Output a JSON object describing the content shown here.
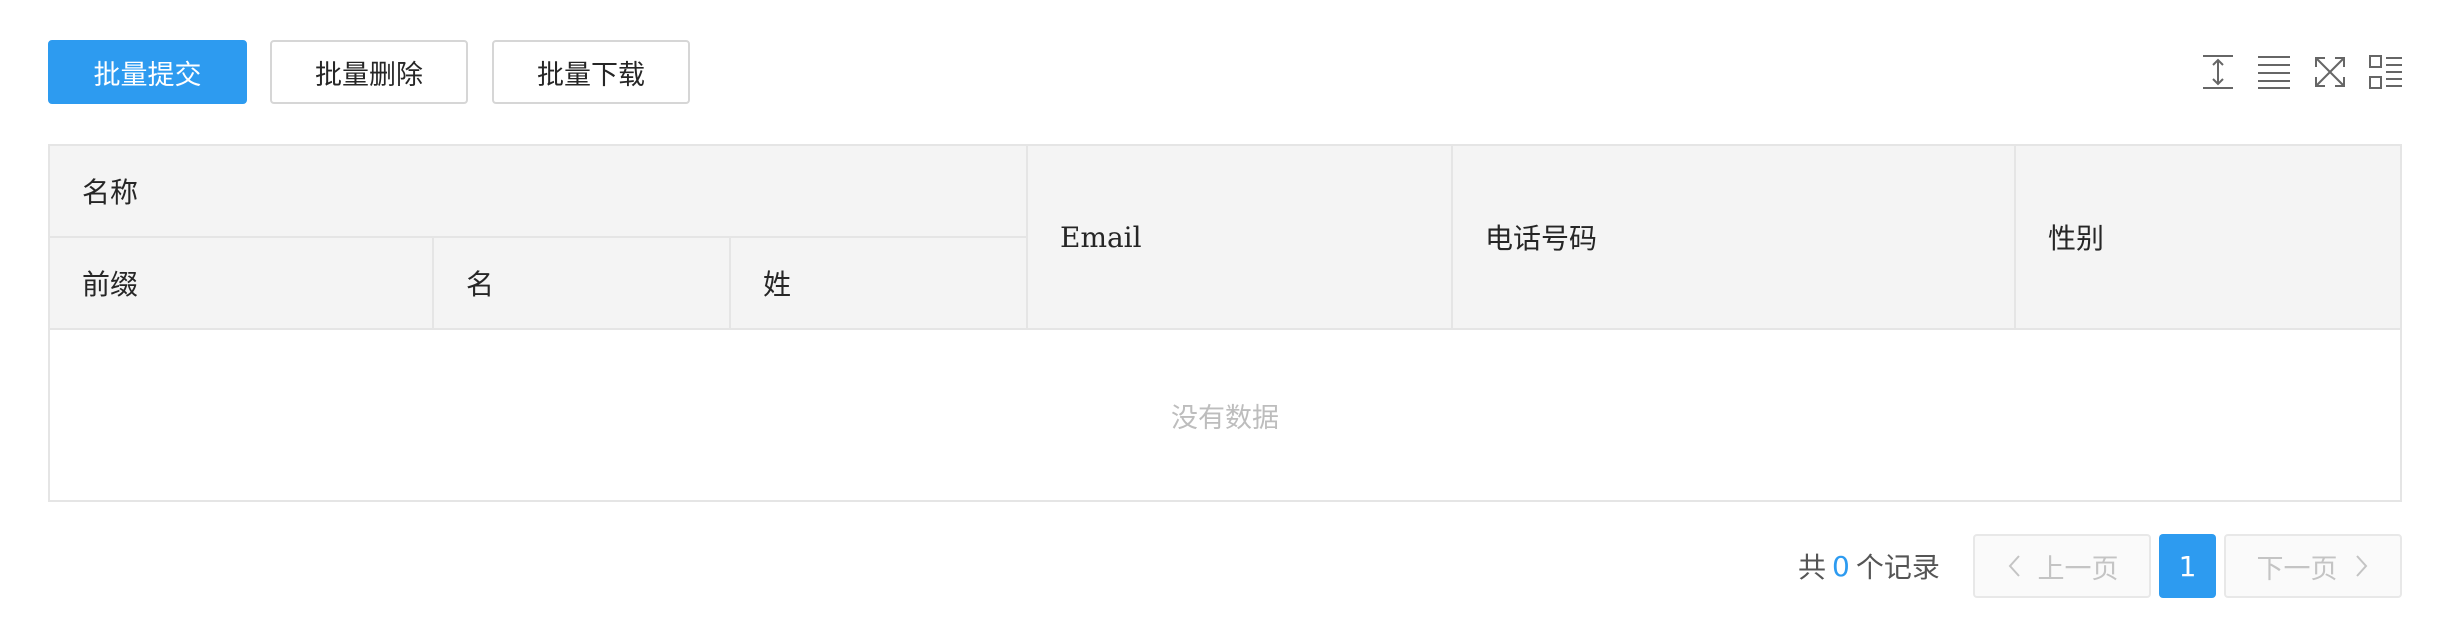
{
  "toolbar": {
    "batch_submit": "批量提交",
    "batch_delete": "批量删除",
    "batch_download": "批量下载",
    "icons": [
      "row-height-icon",
      "density-icon",
      "fullscreen-icon",
      "column-settings-icon"
    ]
  },
  "table": {
    "group_header": "名称",
    "columns": {
      "prefix": "前缀",
      "first_name": "名",
      "last_name": "姓",
      "email": "Email",
      "phone": "电话号码",
      "gender": "性别"
    },
    "empty_text": "没有数据"
  },
  "pagination": {
    "total_prefix": "共",
    "total_count": "0",
    "total_suffix": "个记录",
    "prev_label": "上一页",
    "current_page": "1",
    "next_label": "下一页"
  },
  "colors": {
    "primary": "#2d9bf0",
    "header_bg": "#f4f4f4",
    "border": "#e5e5e5",
    "muted_text": "#bdbdbd"
  }
}
